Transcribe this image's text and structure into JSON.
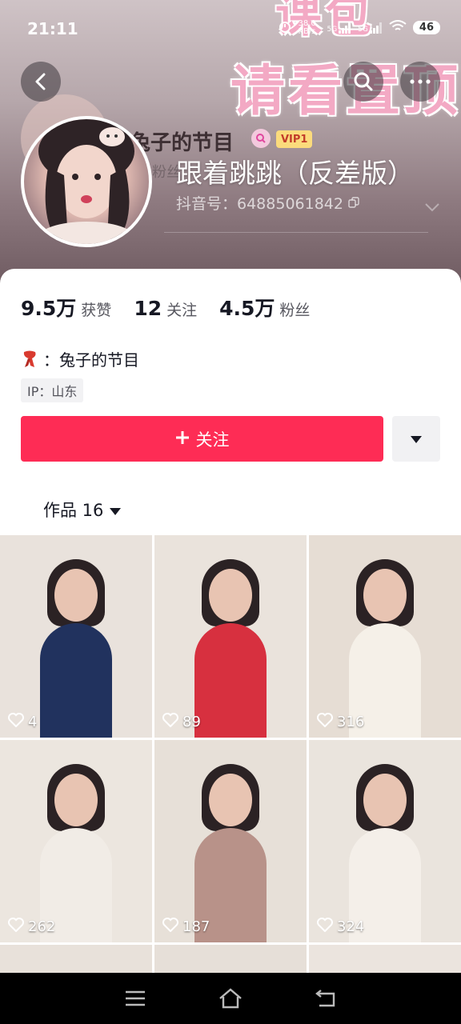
{
  "status_bar": {
    "time": "21:11",
    "net_speed": "38.0 KB/s",
    "signal_1": "5G",
    "signal_2": "5G",
    "battery": "46"
  },
  "header": {
    "banner_line1": "课包",
    "banner_line2": "请看置顶",
    "ghost_name": "兔子的节目",
    "vip_label": "VIP1",
    "ghost_fans": "粉丝",
    "display_name": "跟着跳跳（反差版）",
    "douyin_id": "抖音号：64885061842"
  },
  "stats": [
    {
      "value": "9.5万",
      "label": "获赞"
    },
    {
      "value": "12",
      "label": "关注"
    },
    {
      "value": "4.5万",
      "label": "粉丝"
    }
  ],
  "bio": {
    "text": "：兔子的节目",
    "ip": "IP：山东"
  },
  "actions": {
    "follow_label": "关注"
  },
  "works_tab": {
    "label": "作品 16"
  },
  "videos": [
    {
      "likes": "4",
      "bg": "#e9e2dc",
      "outfit": "#21325e"
    },
    {
      "likes": "89",
      "bg": "#eae3dc",
      "outfit": "#d7303f"
    },
    {
      "likes": "316",
      "bg": "#e6ddd4",
      "outfit": "#f5f0e8"
    },
    {
      "likes": "262",
      "bg": "#ece6df",
      "outfit": "#f1ece6"
    },
    {
      "likes": "187",
      "bg": "#e7e0d8",
      "outfit": "#b89289"
    },
    {
      "likes": "324",
      "bg": "#eae4dd",
      "outfit": "#f4efe9"
    }
  ],
  "colors": {
    "accent": "#fe2c55",
    "text_primary": "#161823",
    "text_secondary": "#56565e"
  }
}
